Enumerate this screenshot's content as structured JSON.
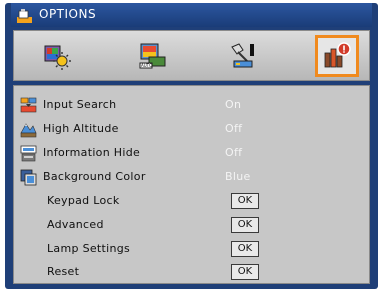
{
  "window": {
    "title": "OPTIONS"
  },
  "tabs": [
    {
      "name": "image",
      "icon": "image-settings-icon"
    },
    {
      "name": "display",
      "icon": "display-settings-icon"
    },
    {
      "name": "setup",
      "icon": "setup-icon"
    },
    {
      "name": "options",
      "icon": "options-icon",
      "active": true
    }
  ],
  "menu": {
    "items": [
      {
        "label": "Input Search",
        "value": "On",
        "icon": "input-search-icon"
      },
      {
        "label": "High Altitude",
        "value": "Off",
        "icon": "high-altitude-icon"
      },
      {
        "label": "Information Hide",
        "value": "Off",
        "icon": "information-hide-icon"
      },
      {
        "label": "Background Color",
        "value": "Blue",
        "icon": "background-color-icon"
      },
      {
        "label": "Keypad Lock",
        "button": "OK"
      },
      {
        "label": "Advanced",
        "button": "OK"
      },
      {
        "label": "Lamp Settings",
        "button": "OK"
      },
      {
        "label": "Reset",
        "button": "OK"
      }
    ]
  },
  "colors": {
    "accent": "#f08a1e",
    "frame": "#1f3f78",
    "panel": "#c7c7c7",
    "value": "#f4f4f4"
  }
}
